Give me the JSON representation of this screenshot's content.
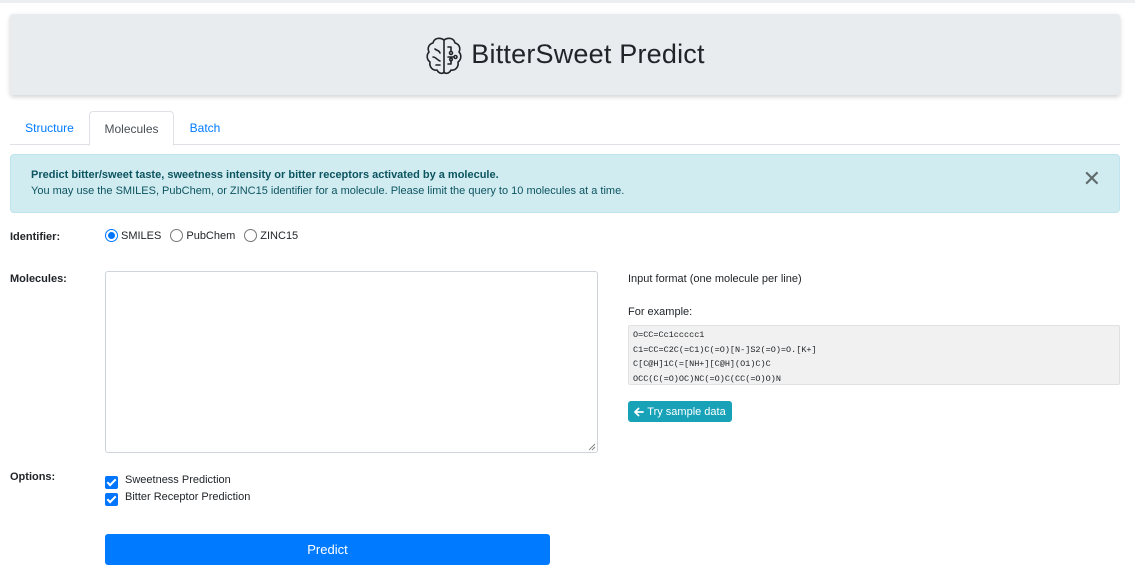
{
  "header": {
    "title": "BitterSweet Predict",
    "logo_icon": "brain-circuit-icon"
  },
  "tabs": [
    {
      "label": "Structure",
      "active": false
    },
    {
      "label": "Molecules",
      "active": true
    },
    {
      "label": "Batch",
      "active": false
    }
  ],
  "alert": {
    "headline": "Predict bitter/sweet taste, sweetness intensity or bitter receptors activated by a molecule.",
    "body": "You may use the SMILES, PubChem, or ZINC15 identifier for a molecule. Please limit the query to 10 molecules at a time.",
    "close": "✕"
  },
  "identifier": {
    "label": "Identifier:",
    "options": [
      "SMILES",
      "PubChem",
      "ZINC15"
    ],
    "selected": "SMILES"
  },
  "molecules": {
    "label": "Molecules:",
    "value": "",
    "help_format": "Input format (one molecule per line)",
    "help_example": "For example:",
    "examples": [
      "O=CC=Cc1ccccc1",
      "C1=CC=C2C(=C1)C(=O)[N-]S2(=O)=O.[K+]",
      "C[C@H]1C(=[NH+][C@H](O1)C)C",
      "OCC(C(=O)OC)NC(=O)C(CC(=O)O)N"
    ],
    "sample_button": "Try sample data"
  },
  "options": {
    "label": "Options:",
    "items": [
      {
        "label": "Sweetness Prediction",
        "checked": true
      },
      {
        "label": "Bitter Receptor Prediction",
        "checked": true
      }
    ]
  },
  "predict_button": "Predict",
  "colors": {
    "primary": "#007bff",
    "info": "#17a2b8",
    "alert_bg": "#d1ecf1",
    "alert_text": "#0c5460"
  }
}
